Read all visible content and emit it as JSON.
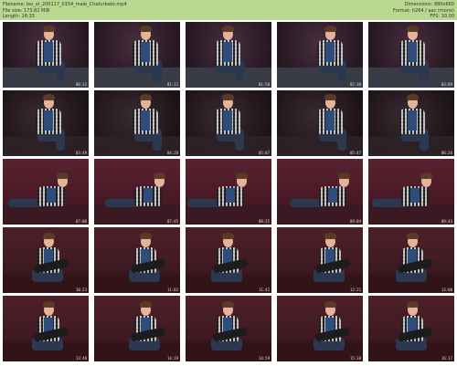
{
  "header": {
    "filename": "Filename: leo_st_200117_0154_male_Chaturbate.mp4",
    "filesize": "File size: 173.82 MiB",
    "length": "Length: 16:33",
    "dimensions": "Dimensions: 880x660",
    "format": "Format: h264 / aac (mono)",
    "fps": "FPS: 30.00"
  },
  "thumbnails": [
    {
      "timestamp": "00:32"
    },
    {
      "timestamp": "01:11"
    },
    {
      "timestamp": "01:50"
    },
    {
      "timestamp": "02:30"
    },
    {
      "timestamp": "03:09"
    },
    {
      "timestamp": "03:49"
    },
    {
      "timestamp": "04:28"
    },
    {
      "timestamp": "05:07"
    },
    {
      "timestamp": "05:47"
    },
    {
      "timestamp": "06:26"
    },
    {
      "timestamp": "07:06"
    },
    {
      "timestamp": "07:45"
    },
    {
      "timestamp": "08:25"
    },
    {
      "timestamp": "09:04"
    },
    {
      "timestamp": "09:43"
    },
    {
      "timestamp": "10:23"
    },
    {
      "timestamp": "11:02"
    },
    {
      "timestamp": "11:42"
    },
    {
      "timestamp": "12:21"
    },
    {
      "timestamp": "13:00"
    },
    {
      "timestamp": "13:40"
    },
    {
      "timestamp": "14:19"
    },
    {
      "timestamp": "14:59"
    },
    {
      "timestamp": "15:38"
    },
    {
      "timestamp": "16:17"
    }
  ]
}
